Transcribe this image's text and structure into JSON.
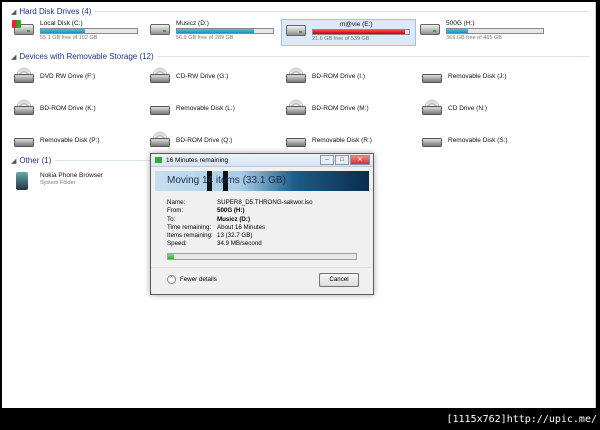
{
  "sections": {
    "hard_disk": "Hard Disk Drives (4)",
    "removable": "Devices with Removable Storage (12)",
    "other": "Other (1)"
  },
  "hard_disks": [
    {
      "name": "Local Disk (C:)",
      "free": "55.1 GB free of 102 GB",
      "used_fraction": 0.46
    },
    {
      "name": "Musicz (D:)",
      "free": "56.9 GB free of 289 GB",
      "used_fraction": 0.8
    },
    {
      "name": "m@vie (E:)",
      "free": "21.6 GB free of 539 GB",
      "used_fraction": 0.96
    },
    {
      "name": "500G (H:)",
      "free": "363 GB free of 465 GB",
      "used_fraction": 0.22
    }
  ],
  "removable_drives": [
    "DVD RW Drive (F:)",
    "CD-RW Drive (G:)",
    "BD-ROM Drive (I:)",
    "Removable Disk (J:)",
    "BD-ROM Drive (K:)",
    "Removable Disk (L:)",
    "BD-ROM Drive (M:)",
    "CD Drive (N:)",
    "Removable Disk (P:)",
    "BD-ROM Drive (Q:)",
    "Removable Disk (R:)",
    "Removable Disk (S:)"
  ],
  "other_items": [
    {
      "name": "Nokia Phone Browser",
      "sub": "System Folder"
    }
  ],
  "dialog": {
    "title": "16 Minutes remaining",
    "banner": "Moving 14 items (33.1 GB)",
    "labels": {
      "name": "Name:",
      "from": "From:",
      "to": "To:",
      "time": "Time remaining:",
      "items": "Items remaining:",
      "speed": "Speed:"
    },
    "values": {
      "name": "SUPER8_D5.THRONG-sakwor.iso",
      "from": "500G (H:)",
      "to": "Musicz (D:)",
      "time": "About 16 Minutes",
      "items": "13 (32.7 GB)",
      "speed": "34.9 MB/second"
    },
    "progress_fraction": 0.03,
    "fewer_details": "Fewer details",
    "cancel": "Cancel"
  },
  "watermark": "[1115x762]http://upic.me/"
}
